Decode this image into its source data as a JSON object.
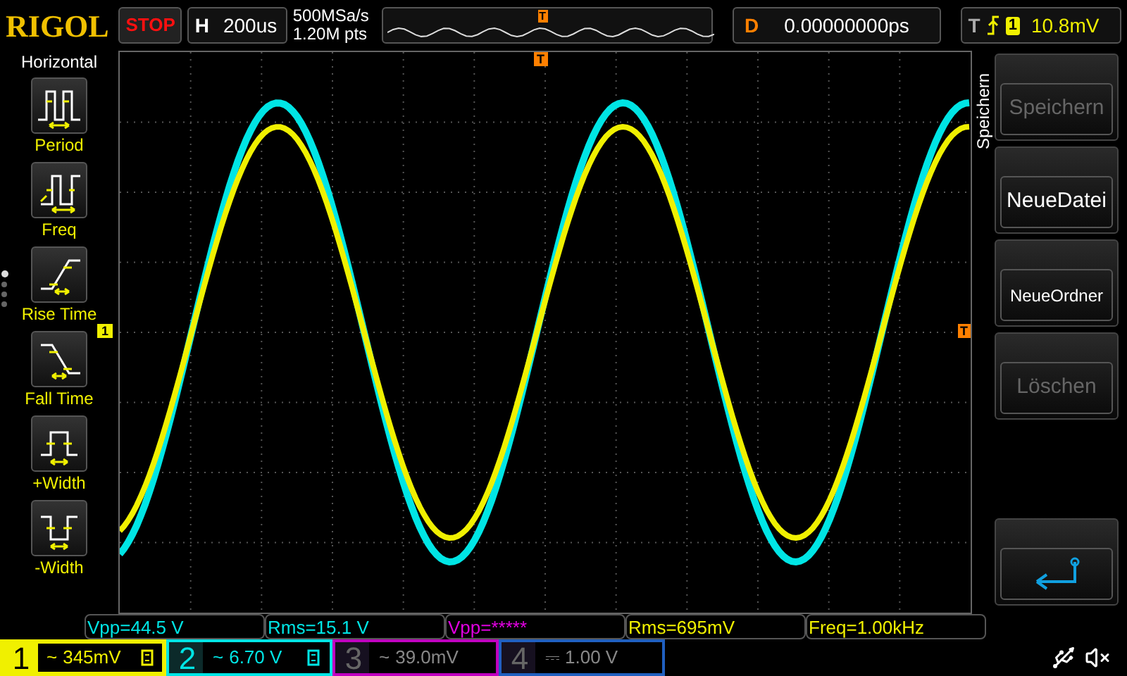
{
  "header": {
    "brand": "RIGOL",
    "run_state": "STOP",
    "timebase": {
      "label": "H",
      "value": "200us"
    },
    "sample_rate": "500MSa/s",
    "memory_depth": "1.20M pts",
    "overview_marker": "T",
    "delay": {
      "label": "D",
      "value": "0.00000000ps"
    },
    "trigger": {
      "label": "T",
      "source": "1",
      "level": "10.8mV"
    }
  },
  "left_menu": {
    "title": "Horizontal",
    "pages": [
      {
        "selected": true
      },
      {
        "selected": false
      },
      {
        "selected": false
      },
      {
        "selected": false
      }
    ],
    "items": [
      {
        "kind": "period",
        "label": "Period"
      },
      {
        "kind": "freq",
        "label": "Freq"
      },
      {
        "kind": "rise",
        "label": "Rise Time"
      },
      {
        "kind": "fall",
        "label": "Fall Time"
      },
      {
        "kind": "pwidth",
        "label": "+Width"
      },
      {
        "kind": "nwidth",
        "label": "-Width"
      }
    ]
  },
  "plot": {
    "trigger_position_marker": "T",
    "trigger_level_marker": "T",
    "channel_marker": "1"
  },
  "right_menu": {
    "title": "Speichern",
    "items": [
      {
        "kind": "text",
        "label": "Speichern",
        "disabled": true
      },
      {
        "kind": "text",
        "label": "NeueDatei",
        "disabled": false
      },
      {
        "kind": "text",
        "label": "NeueOrdner",
        "disabled": false
      },
      {
        "kind": "text",
        "label": "Löschen",
        "disabled": true
      },
      {
        "kind": "back"
      }
    ]
  },
  "measurements": [
    {
      "text": "Vpp=44.5 V",
      "kind": "ch2"
    },
    {
      "text": "Rms=15.1 V",
      "kind": "ch2"
    },
    {
      "text": "Vpp=*****",
      "kind": "ch3"
    },
    {
      "text": "Rms=695mV",
      "kind": "ch1"
    },
    {
      "text": "Freq=1.00kHz",
      "kind": "ch1"
    }
  ],
  "channels": [
    {
      "number": "1",
      "coupling": "~",
      "scale": "345mV",
      "selected": true,
      "enabled": true,
      "bw_limit": true,
      "color": "#f0f000"
    },
    {
      "number": "2",
      "coupling": "~",
      "scale": "6.70 V",
      "selected": false,
      "enabled": true,
      "bw_limit": true,
      "color": "#00e5e5"
    },
    {
      "number": "3",
      "coupling": "~",
      "scale": "39.0mV",
      "selected": false,
      "enabled": false,
      "bw_limit": false,
      "color": "#c000c0"
    },
    {
      "number": "4",
      "coupling": "⎓",
      "scale": "1.00 V",
      "selected": false,
      "enabled": false,
      "bw_limit": false,
      "color": "#2060c0"
    }
  ]
}
